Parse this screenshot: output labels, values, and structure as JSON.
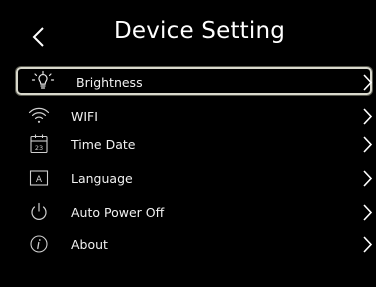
{
  "header": {
    "title": "Device Setting",
    "back_icon": "chevron-left-icon"
  },
  "menu": {
    "items": [
      {
        "label": "Brightness",
        "icon": "lightbulb-icon",
        "selected": true
      },
      {
        "label": "WIFI",
        "icon": "wifi-icon",
        "selected": false
      },
      {
        "label": "Time Date",
        "icon": "calendar-icon",
        "selected": false
      },
      {
        "label": "Language",
        "icon": "language-icon",
        "selected": false
      },
      {
        "label": "Auto Power Off",
        "icon": "power-icon",
        "selected": false
      },
      {
        "label": "About",
        "icon": "info-icon",
        "selected": false
      }
    ]
  },
  "calendar_day": "23",
  "language_glyph": "A",
  "colors": {
    "background": "#000000",
    "text": "#ffffff",
    "selection_border": "#d8d8cc",
    "icon": "#cfcfcf"
  }
}
